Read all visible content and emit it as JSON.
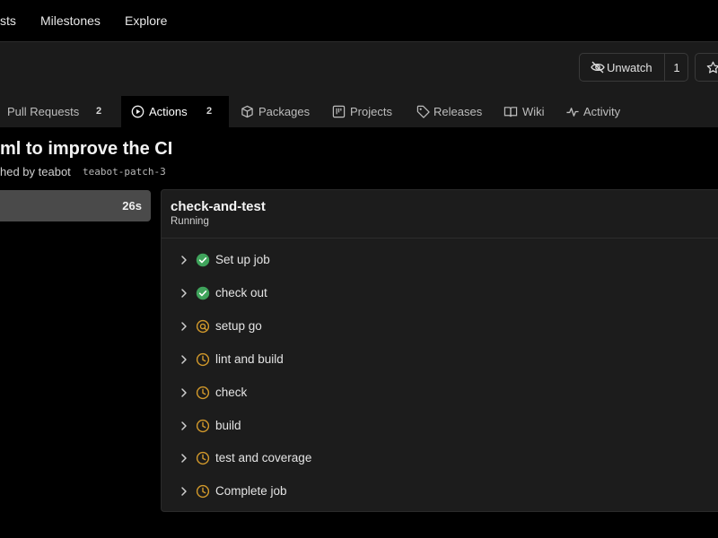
{
  "topnav": {
    "items": [
      "sts",
      "Milestones",
      "Explore"
    ]
  },
  "repo": {
    "watch_label": "Unwatch",
    "watch_count": "1"
  },
  "tabs": [
    {
      "label": "Pull Requests",
      "badge": "2",
      "icon": "pull-request-icon"
    },
    {
      "label": "Actions",
      "badge": "2",
      "icon": "play-circle-icon",
      "active": true
    },
    {
      "label": "Packages",
      "icon": "package-icon"
    },
    {
      "label": "Projects",
      "icon": "project-board-icon"
    },
    {
      "label": "Releases",
      "icon": "tag-icon"
    },
    {
      "label": "Wiki",
      "icon": "book-icon"
    },
    {
      "label": "Activity",
      "icon": "pulse-icon"
    }
  ],
  "run": {
    "title": "ml to improve the CI",
    "subline": "hed by teabot",
    "branch": "teabot-patch-3"
  },
  "jobs": [
    {
      "duration": "26s"
    }
  ],
  "job_panel": {
    "name": "check-and-test",
    "status": "Running",
    "steps": [
      {
        "label": "Set up job",
        "state": "success"
      },
      {
        "label": "check out",
        "state": "success"
      },
      {
        "label": "setup go",
        "state": "running"
      },
      {
        "label": "lint and build",
        "state": "waiting"
      },
      {
        "label": "check",
        "state": "waiting"
      },
      {
        "label": "build",
        "state": "waiting"
      },
      {
        "label": "test and coverage",
        "state": "waiting"
      },
      {
        "label": "Complete job",
        "state": "waiting"
      }
    ]
  },
  "colors": {
    "success": "#3fa35b",
    "pending": "#d2992b",
    "background": "#000000",
    "panel": "#1c1c1c"
  }
}
